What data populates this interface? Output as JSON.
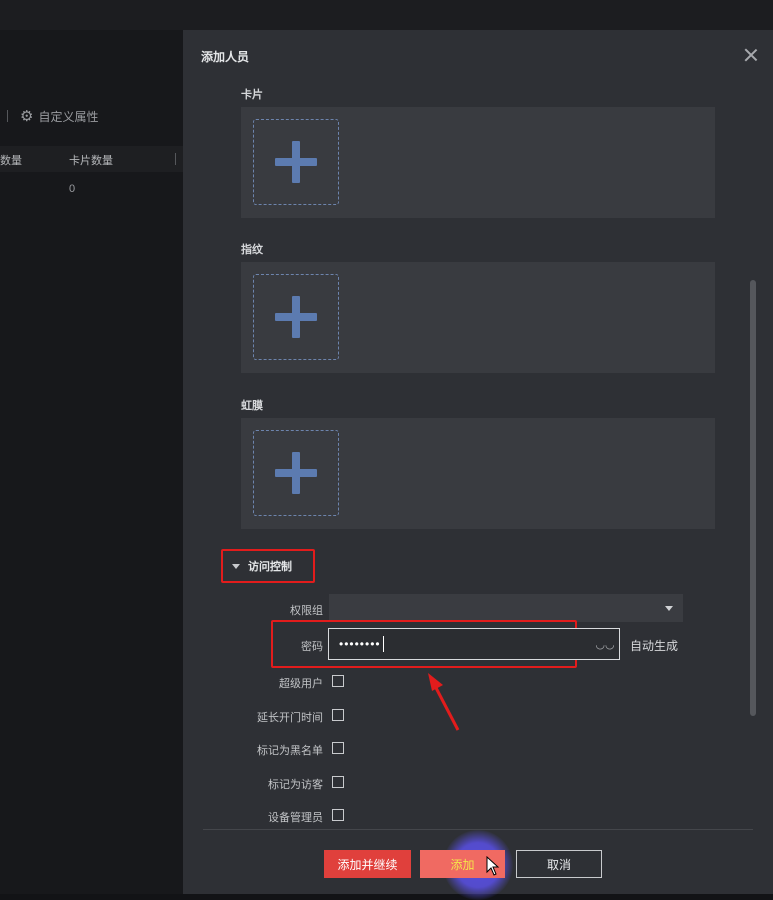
{
  "background": {
    "toolbar_label": "自定义属性",
    "table_headers": [
      "数量",
      "卡片数量"
    ],
    "cell_value": "0"
  },
  "dialog": {
    "title": "添加人员",
    "sections": {
      "card": "卡片",
      "fingerprint": "指纹",
      "iris": "虹膜"
    },
    "access_control": {
      "title": "访问控制",
      "permission_group_label": "权限组",
      "permission_group_value": "",
      "password_label": "密码",
      "password_value": "••••••••",
      "auto_generate": "自动生成",
      "checkboxes": [
        {
          "label": "超级用户",
          "checked": false
        },
        {
          "label": "延长开门时间",
          "checked": false
        },
        {
          "label": "标记为黑名单",
          "checked": false
        },
        {
          "label": "标记为访客",
          "checked": false
        },
        {
          "label": "设备管理员",
          "checked": false
        }
      ]
    },
    "buttons": {
      "add_continue": "添加并继续",
      "add": "添加",
      "cancel": "取消"
    }
  },
  "colors": {
    "highlight": "#e21c1c",
    "primary_button": "#e0403c",
    "plus_icon": "#5c7bb0"
  }
}
